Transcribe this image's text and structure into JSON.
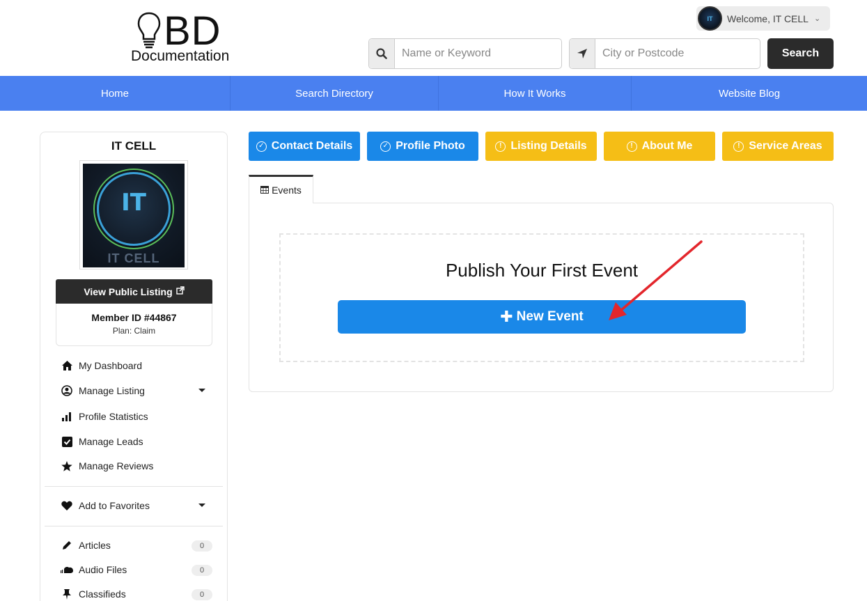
{
  "header": {
    "logo_main": "BD",
    "logo_sub": "Documentation",
    "welcome": "Welcome, IT CELL",
    "avatar_text": "IT",
    "keyword_placeholder": "Name or Keyword",
    "location_placeholder": "City or Postcode",
    "search_label": "Search"
  },
  "nav": {
    "items": [
      {
        "label": "Home"
      },
      {
        "label": "Search Directory"
      },
      {
        "label": "How It Works"
      },
      {
        "label": "Website Blog"
      }
    ],
    "color": "#4a80f0"
  },
  "sidebar": {
    "name": "IT CELL",
    "photo_text_main": "IT",
    "photo_text_sub": "IT CELL",
    "view_public_label": "View Public Listing",
    "member_id": "Member ID #44867",
    "plan": "Plan: Claim",
    "menu": [
      {
        "label": "My Dashboard",
        "icon": "home-icon"
      },
      {
        "label": "Manage Listing",
        "icon": "user-circle-icon"
      },
      {
        "label": "Profile Statistics",
        "icon": "bar-chart-icon"
      },
      {
        "label": "Manage Leads",
        "icon": "check-square-icon"
      },
      {
        "label": "Manage Reviews",
        "icon": "star-icon"
      }
    ],
    "favorites_label": "Add to Favorites",
    "content": [
      {
        "label": "Articles",
        "count": "0",
        "icon": "pencil-icon"
      },
      {
        "label": "Audio Files",
        "count": "0",
        "icon": "soundcloud-icon"
      },
      {
        "label": "Classifieds",
        "count": "0",
        "icon": "pin-icon"
      }
    ]
  },
  "steps": [
    {
      "label": "Contact Details",
      "status": "done",
      "color": "#1a88e8"
    },
    {
      "label": "Profile Photo",
      "status": "done",
      "color": "#1a88e8"
    },
    {
      "label": "Listing Details",
      "status": "incomplete",
      "color": "#f5be16"
    },
    {
      "label": "About Me",
      "status": "incomplete",
      "color": "#f5be16"
    },
    {
      "label": "Service Areas",
      "status": "incomplete",
      "color": "#f5be16"
    }
  ],
  "main": {
    "tab_label": "Events",
    "publish_title": "Publish Your First Event",
    "new_event_label": "New Event"
  },
  "annotation": {
    "arrow_color": "#e3262c"
  }
}
